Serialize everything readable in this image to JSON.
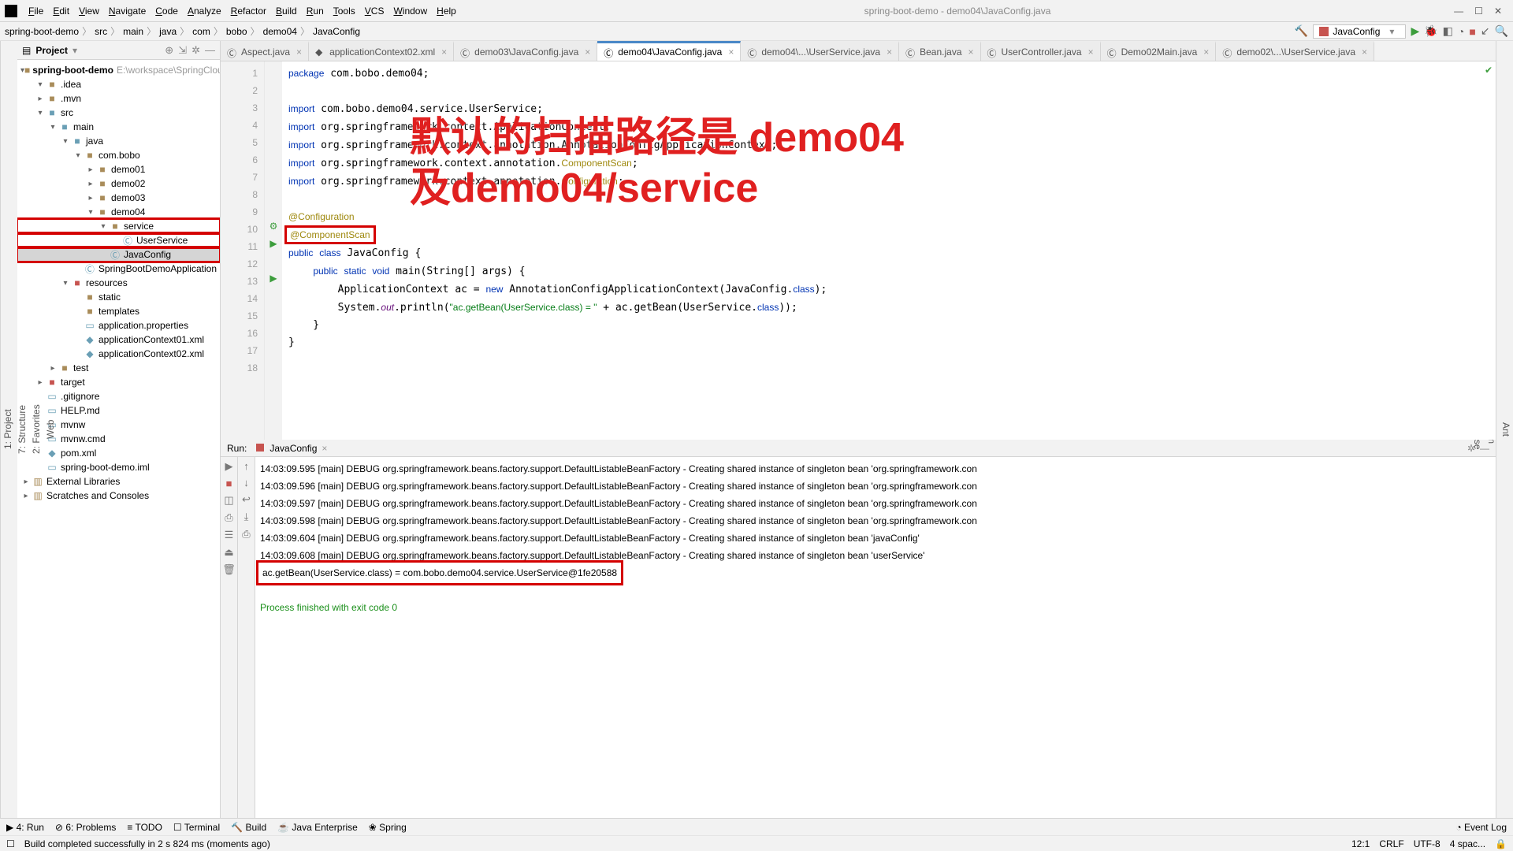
{
  "window": {
    "context": "spring-boot-demo - demo04\\JavaConfig.java"
  },
  "menu": [
    "File",
    "Edit",
    "View",
    "Navigate",
    "Code",
    "Analyze",
    "Refactor",
    "Build",
    "Run",
    "Tools",
    "VCS",
    "Window",
    "Help"
  ],
  "breadcrumb": [
    "spring-boot-demo",
    "src",
    "main",
    "java",
    "com",
    "bobo",
    "demo04",
    "JavaConfig"
  ],
  "run_config": {
    "name": "JavaConfig"
  },
  "project": {
    "title": "Project",
    "root": "spring-boot-demo",
    "rootHint": "E:\\workspace\\SpringCloud",
    "nodes": [
      {
        "d": 1,
        "exp": "▾",
        "ic": "folder",
        "nm": ".idea"
      },
      {
        "d": 1,
        "exp": "▸",
        "ic": "folder",
        "nm": ".mvn"
      },
      {
        "d": 1,
        "exp": "▾",
        "ic": "folder-blue",
        "nm": "src"
      },
      {
        "d": 2,
        "exp": "▾",
        "ic": "folder-blue",
        "nm": "main"
      },
      {
        "d": 3,
        "exp": "▾",
        "ic": "folder-blue",
        "nm": "java"
      },
      {
        "d": 4,
        "exp": "▾",
        "ic": "folder",
        "nm": "com.bobo"
      },
      {
        "d": 5,
        "exp": "▸",
        "ic": "folder",
        "nm": "demo01"
      },
      {
        "d": 5,
        "exp": "▸",
        "ic": "folder",
        "nm": "demo02"
      },
      {
        "d": 5,
        "exp": "▸",
        "ic": "folder",
        "nm": "demo03"
      },
      {
        "d": 5,
        "exp": "▾",
        "ic": "folder",
        "nm": "demo04"
      },
      {
        "d": 6,
        "exp": "▾",
        "ic": "folder",
        "nm": "service",
        "red": true
      },
      {
        "d": 7,
        "exp": "",
        "ic": "class",
        "nm": "UserService",
        "red": true
      },
      {
        "d": 6,
        "exp": "",
        "ic": "class",
        "nm": "JavaConfig",
        "sel": true,
        "red": true
      },
      {
        "d": 4,
        "exp": "",
        "ic": "class",
        "nm": "SpringBootDemoApplication"
      },
      {
        "d": 3,
        "exp": "▾",
        "ic": "folder-red",
        "nm": "resources"
      },
      {
        "d": 4,
        "exp": "",
        "ic": "folder",
        "nm": "static"
      },
      {
        "d": 4,
        "exp": "",
        "ic": "folder",
        "nm": "templates"
      },
      {
        "d": 4,
        "exp": "",
        "ic": "file",
        "nm": "application.properties"
      },
      {
        "d": 4,
        "exp": "",
        "ic": "xml",
        "nm": "applicationContext01.xml"
      },
      {
        "d": 4,
        "exp": "",
        "ic": "xml",
        "nm": "applicationContext02.xml"
      },
      {
        "d": 2,
        "exp": "▸",
        "ic": "folder",
        "nm": "test"
      },
      {
        "d": 1,
        "exp": "▸",
        "ic": "folder-red",
        "nm": "target"
      },
      {
        "d": 1,
        "exp": "",
        "ic": "file",
        "nm": ".gitignore"
      },
      {
        "d": 1,
        "exp": "",
        "ic": "file",
        "nm": "HELP.md"
      },
      {
        "d": 1,
        "exp": "",
        "ic": "file",
        "nm": "mvnw"
      },
      {
        "d": 1,
        "exp": "",
        "ic": "file",
        "nm": "mvnw.cmd"
      },
      {
        "d": 1,
        "exp": "",
        "ic": "xml",
        "nm": "pom.xml"
      },
      {
        "d": 1,
        "exp": "",
        "ic": "file",
        "nm": "spring-boot-demo.iml"
      }
    ],
    "extern": "External Libraries",
    "scratches": "Scratches and Consoles"
  },
  "tabs": [
    {
      "label": "Aspect.java",
      "active": false,
      "ic": "class"
    },
    {
      "label": "applicationContext02.xml",
      "active": false,
      "ic": "xml"
    },
    {
      "label": "demo03\\JavaConfig.java",
      "active": false,
      "ic": "class"
    },
    {
      "label": "demo04\\JavaConfig.java",
      "active": true,
      "ic": "class"
    },
    {
      "label": "demo04\\...\\UserService.java",
      "active": false,
      "ic": "class"
    },
    {
      "label": "Bean.java",
      "active": false,
      "ic": "class"
    },
    {
      "label": "UserController.java",
      "active": false,
      "ic": "class"
    },
    {
      "label": "Demo02Main.java",
      "active": false,
      "ic": "class"
    },
    {
      "label": "demo02\\...\\UserService.java",
      "active": false,
      "ic": "class"
    }
  ],
  "overlay": {
    "line1": "默认的扫描路径是 demo04",
    "line2": "及demo04/service"
  },
  "code": {
    "lines": [
      1,
      2,
      3,
      4,
      5,
      6,
      7,
      8,
      9,
      10,
      11,
      12,
      13,
      14,
      15,
      16,
      17,
      18
    ]
  },
  "run": {
    "label": "Run:",
    "config": "JavaConfig",
    "log": [
      "14:03:09.595 [main] DEBUG org.springframework.beans.factory.support.DefaultListableBeanFactory - Creating shared instance of singleton bean 'org.springframework.con",
      "14:03:09.596 [main] DEBUG org.springframework.beans.factory.support.DefaultListableBeanFactory - Creating shared instance of singleton bean 'org.springframework.con",
      "14:03:09.597 [main] DEBUG org.springframework.beans.factory.support.DefaultListableBeanFactory - Creating shared instance of singleton bean 'org.springframework.con",
      "14:03:09.598 [main] DEBUG org.springframework.beans.factory.support.DefaultListableBeanFactory - Creating shared instance of singleton bean 'org.springframework.con",
      "14:03:09.604 [main] DEBUG org.springframework.beans.factory.support.DefaultListableBeanFactory - Creating shared instance of singleton bean 'javaConfig'",
      "14:03:09.608 [main] DEBUG org.springframework.beans.factory.support.DefaultListableBeanFactory - Creating shared instance of singleton bean 'userService'"
    ],
    "result": "ac.getBean(UserService.class) = com.bobo.demo04.service.UserService@1fe20588",
    "exit": "Process finished with exit code 0"
  },
  "bottom": {
    "run": "4: Run",
    "problems": "6: Problems",
    "todo": "TODO",
    "terminal": "Terminal",
    "build": "Build",
    "je": "Java Enterprise",
    "spring": "Spring",
    "evt": "Event Log"
  },
  "status": {
    "msg": "Build completed successfully in 2 s 824 ms (moments ago)",
    "pos": "12:1",
    "crlf": "CRLF",
    "enc": "UTF-8",
    "sp": "4 spac..."
  }
}
